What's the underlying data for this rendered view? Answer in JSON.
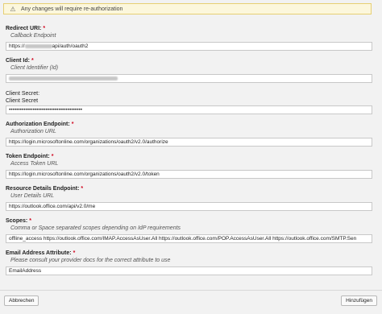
{
  "warning": {
    "icon": "warning-triangle-icon",
    "text": "Any changes will require re-authorization"
  },
  "redirect": {
    "label": "Redirect URI:",
    "required": "*",
    "help": "Callback Endpoint",
    "value_prefix": "https://",
    "value_suffix": "api/auth/oauth2"
  },
  "client_id": {
    "label": "Client Id:",
    "required": "*",
    "help": "Client Identifier (Id)"
  },
  "client_secret": {
    "label1": "Client Secret:",
    "label2": "Client Secret",
    "value": "••••••••••••••••••••••••••••••••••••••••"
  },
  "auth_endpoint": {
    "label": "Authorization Endpoint:",
    "required": "*",
    "help": "Authorization URL",
    "value": "https://login.microsoftonline.com/organizations/oauth2/v2.0/authorize"
  },
  "token_endpoint": {
    "label": "Token Endpoint:",
    "required": "*",
    "help": "Access Token URL",
    "value": "https://login.microsoftonline.com/organizations/oauth2/v2.0/token"
  },
  "resource_endpoint": {
    "label": "Resource Details Endpoint:",
    "required": "*",
    "help": "User Details URL",
    "value": "https://outlook.office.com/api/v2.0/me"
  },
  "scopes": {
    "label": "Scopes:",
    "required": "*",
    "help": "Comma or Space separated scopes depending on IdP requirements",
    "value": "offline_access https://outlook.office.com/IMAP.AccessAsUser.All https://outlook.office.com/POP.AccessAsUser.All https://outlook.office.com/SMTP.Sen"
  },
  "email_attr": {
    "label": "Email Address Attribute:",
    "required": "*",
    "help": "Please consult your provider docs for the correct attribute to use",
    "value": "EmailAddress"
  },
  "buttons": {
    "cancel": "Abbrechen",
    "add": "Hinzufügen"
  }
}
